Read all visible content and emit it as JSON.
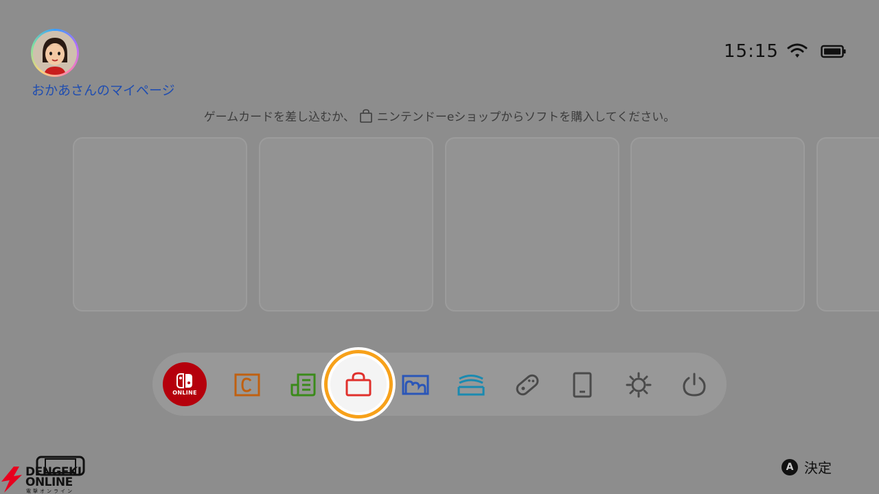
{
  "profile": {
    "name": "おかあさんのマイページ"
  },
  "status": {
    "time": "15:15"
  },
  "message": {
    "before": "ゲームカードを差し込むか、",
    "after": "ニンテンドーeショップからソフトを購入してください。"
  },
  "tiles": [
    {
      "state": "empty"
    },
    {
      "state": "empty"
    },
    {
      "state": "empty"
    },
    {
      "state": "empty"
    },
    {
      "state": "empty"
    }
  ],
  "dock": {
    "online_label": "ONLINE",
    "selected_item": "nintendo-eshop",
    "icon_colors": {
      "online": "#b5000c",
      "news": "#c06010",
      "album_news": "#3a8a1a",
      "eshop": "#e0302c",
      "album": "#2a56b8",
      "controllers": "#1a8ab0",
      "gray": "#4a4a4a",
      "selection_ring": "#f7a11a"
    }
  },
  "footer": {
    "button_glyph": "A",
    "confirm_label": "決定",
    "watermark_line1": "DENGEKI",
    "watermark_line2": "ONLINE",
    "watermark_line3": "電撃オンライン"
  }
}
